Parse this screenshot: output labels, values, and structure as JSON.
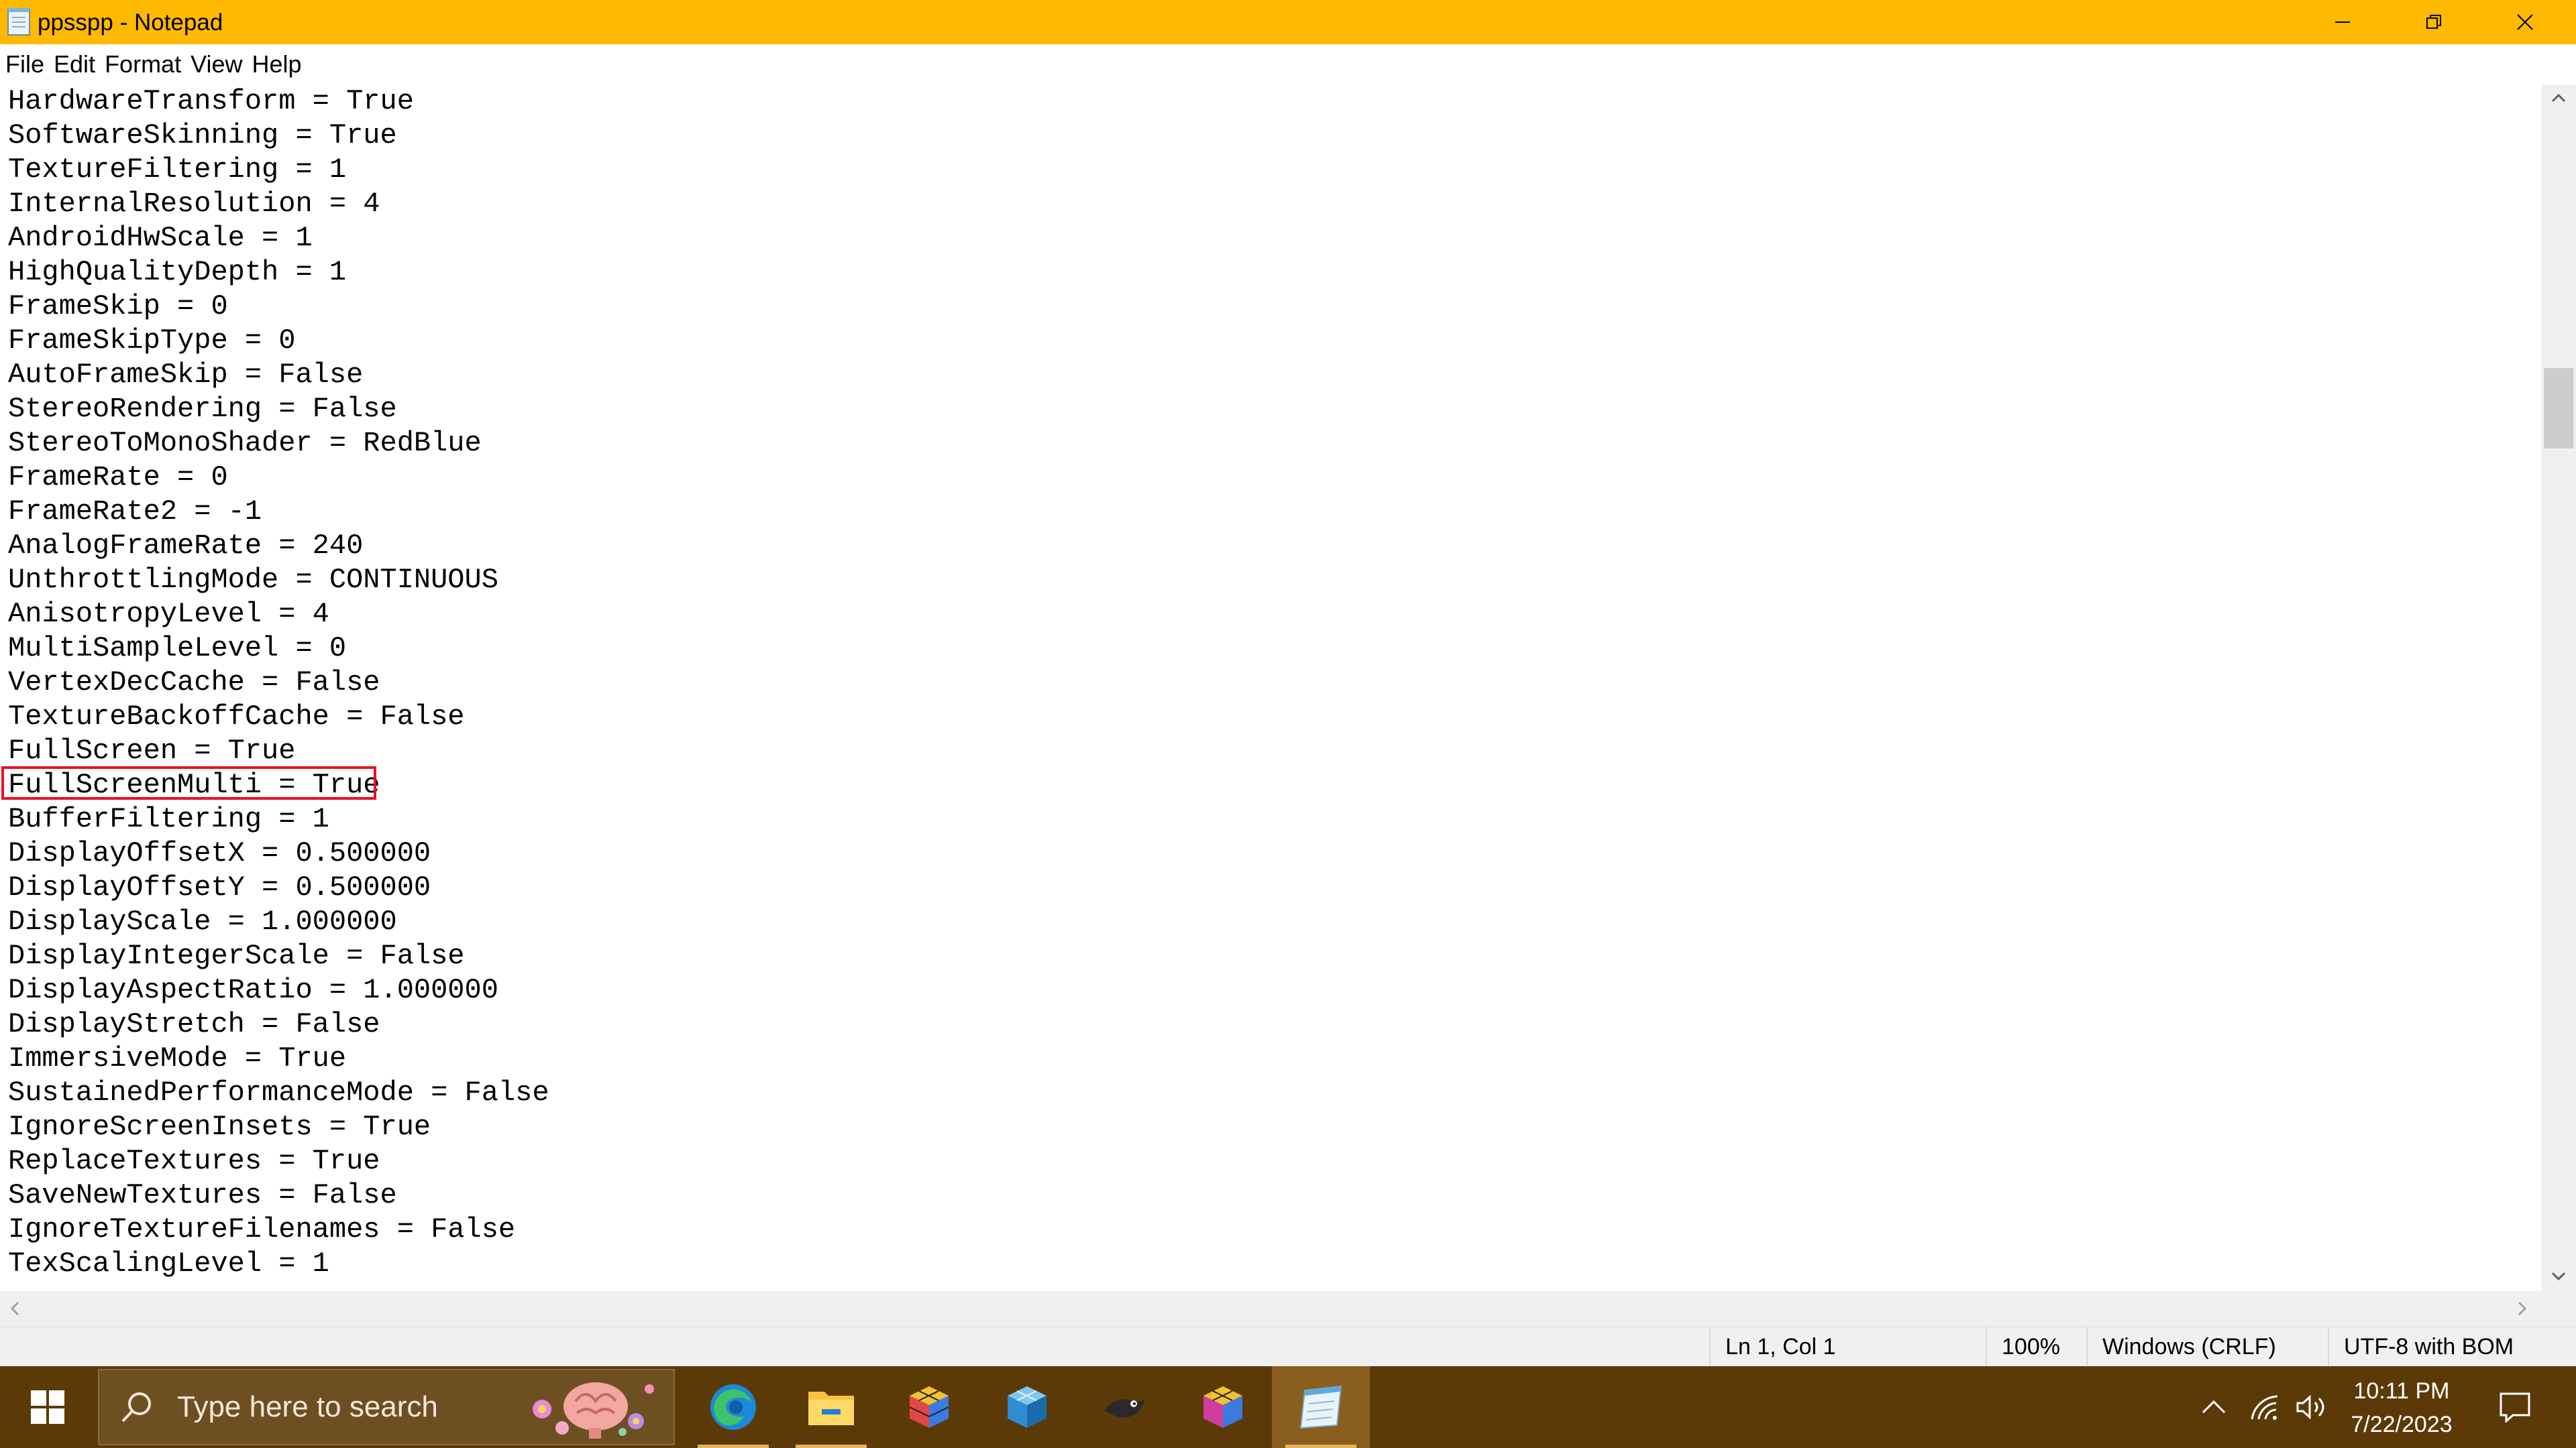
{
  "window": {
    "title": "ppsspp - Notepad",
    "titlebar_color": "#FFB900",
    "controls": [
      "minimize-icon",
      "restore-icon",
      "close-icon"
    ]
  },
  "menu": [
    "File",
    "Edit",
    "Format",
    "View",
    "Help"
  ],
  "editor": {
    "lines": [
      "HardwareTransform = True",
      "SoftwareSkinning = True",
      "TextureFiltering = 1",
      "InternalResolution = 4",
      "AndroidHwScale = 1",
      "HighQualityDepth = 1",
      "FrameSkip = 0",
      "FrameSkipType = 0",
      "AutoFrameSkip = False",
      "StereoRendering = False",
      "StereoToMonoShader = RedBlue",
      "FrameRate = 0",
      "FrameRate2 = -1",
      "AnalogFrameRate = 240",
      "UnthrottlingMode = CONTINUOUS",
      "AnisotropyLevel = 4",
      "MultiSampleLevel = 0",
      "VertexDecCache = False",
      "TextureBackoffCache = False",
      "FullScreen = True",
      "FullScreenMulti = True",
      "BufferFiltering = 1",
      "DisplayOffsetX = 0.500000",
      "DisplayOffsetY = 0.500000",
      "DisplayScale = 1.000000",
      "DisplayIntegerScale = False",
      "DisplayAspectRatio = 1.000000",
      "DisplayStretch = False",
      "ImmersiveMode = True",
      "SustainedPerformanceMode = False",
      "IgnoreScreenInsets = True",
      "ReplaceTextures = True",
      "SaveNewTextures = False",
      "IgnoreTextureFilenames = False",
      "TexScalingLevel = 1"
    ],
    "highlighted_line": "FullScreenMulti = True",
    "highlight_color": "#E81123"
  },
  "statusbar": {
    "position": "Ln 1, Col 1",
    "zoom": "100%",
    "line_ending": "Windows (CRLF)",
    "encoding": "UTF-8 with BOM"
  },
  "taskbar": {
    "search_placeholder": "Type here to search",
    "apps": [
      "edge-icon",
      "file-explorer-icon",
      "cube-app-icon",
      "blue-cube-app-icon",
      "crow-app-icon",
      "cube-app-icon-2",
      "notepad-icon"
    ],
    "time": "10:11 PM",
    "date": "7/22/2023",
    "color": "#5C3A08"
  }
}
